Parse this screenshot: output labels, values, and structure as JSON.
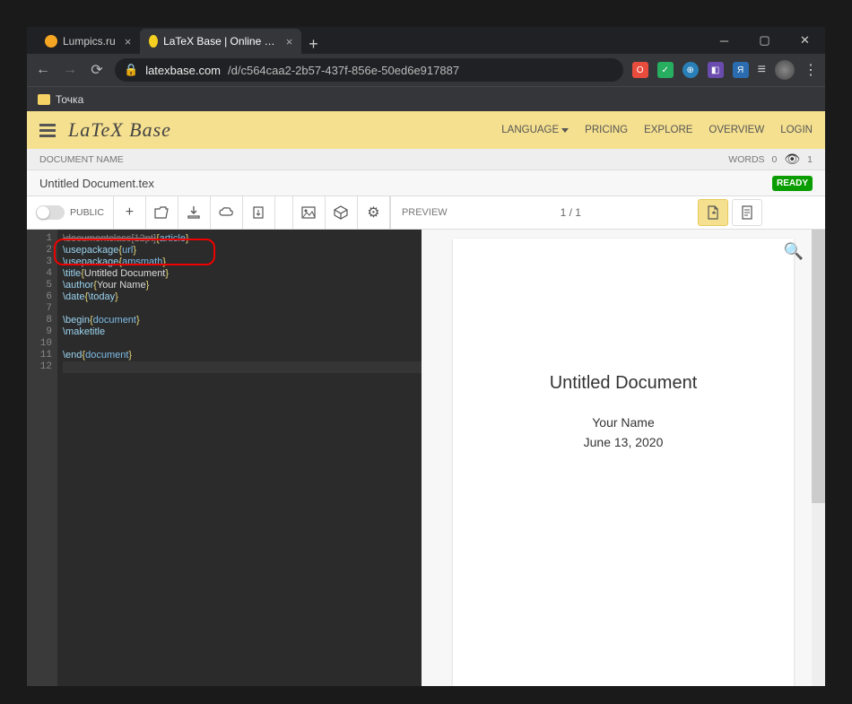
{
  "browser": {
    "tabs": [
      {
        "title": "Lumpics.ru",
        "favicon": "#f5a623",
        "active": false
      },
      {
        "title": "LaTeX Base | Online LaTeX Editor",
        "favicon": "#f5d020",
        "active": true
      }
    ],
    "url_domain": "latexbase.com",
    "url_path": "/d/c564caa2-2b57-437f-856e-50ed6e917887",
    "bookmark": "Точка"
  },
  "app": {
    "brand": "LaTeX Base",
    "nav": {
      "language": "LANGUAGE",
      "pricing": "PRICING",
      "explore": "EXPLORE",
      "overview": "OVERVIEW",
      "login": "LOGIN"
    },
    "docname_label": "DOCUMENT NAME",
    "words_label": "WORDS",
    "words_count": "0",
    "views_count": "1",
    "filename": "Untitled Document.tex",
    "ready": "READY",
    "public_label": "PUBLIC",
    "preview_label": "PREVIEW",
    "page_indicator": "1 / 1"
  },
  "code": {
    "lines": [
      {
        "n": "1",
        "parts": [
          {
            "t": "\\documentclass",
            "c": "tok-comment"
          },
          {
            "t": "[12pt]",
            "c": "tok-comment"
          },
          {
            "t": "{",
            "c": "tok-brace"
          },
          {
            "t": "article",
            "c": "tok-arg"
          },
          {
            "t": "}",
            "c": "tok-brace"
          }
        ]
      },
      {
        "n": "2",
        "parts": [
          {
            "t": "\\usepackage",
            "c": "tok-cmd"
          },
          {
            "t": "{",
            "c": "tok-brace"
          },
          {
            "t": "url",
            "c": "tok-arg"
          },
          {
            "t": "}",
            "c": "tok-brace"
          }
        ]
      },
      {
        "n": "3",
        "parts": [
          {
            "t": "\\usepackage",
            "c": "tok-cmd"
          },
          {
            "t": "{",
            "c": "tok-brace"
          },
          {
            "t": "amsmath",
            "c": "tok-arg"
          },
          {
            "t": "}",
            "c": "tok-brace"
          }
        ]
      },
      {
        "n": "4",
        "parts": [
          {
            "t": "\\title",
            "c": "tok-cmd"
          },
          {
            "t": "{",
            "c": "tok-brace"
          },
          {
            "t": "Untitled Document",
            "c": ""
          },
          {
            "t": "}",
            "c": "tok-brace"
          }
        ]
      },
      {
        "n": "5",
        "parts": [
          {
            "t": "\\author",
            "c": "tok-cmd"
          },
          {
            "t": "{",
            "c": "tok-brace"
          },
          {
            "t": "Your Name",
            "c": ""
          },
          {
            "t": "}",
            "c": "tok-brace"
          }
        ]
      },
      {
        "n": "6",
        "parts": [
          {
            "t": "\\date",
            "c": "tok-cmd"
          },
          {
            "t": "{",
            "c": "tok-brace"
          },
          {
            "t": "\\today",
            "c": "tok-cmd"
          },
          {
            "t": "}",
            "c": "tok-brace"
          }
        ]
      },
      {
        "n": "7",
        "parts": []
      },
      {
        "n": "8",
        "parts": [
          {
            "t": "\\begin",
            "c": "tok-cmd"
          },
          {
            "t": "{",
            "c": "tok-brace"
          },
          {
            "t": "document",
            "c": "tok-arg"
          },
          {
            "t": "}",
            "c": "tok-brace"
          }
        ]
      },
      {
        "n": "9",
        "parts": [
          {
            "t": "\\maketitle",
            "c": "tok-cmd"
          }
        ]
      },
      {
        "n": "10",
        "parts": []
      },
      {
        "n": "11",
        "parts": [
          {
            "t": "\\end",
            "c": "tok-cmd"
          },
          {
            "t": "{",
            "c": "tok-brace"
          },
          {
            "t": "document",
            "c": "tok-arg"
          },
          {
            "t": "}",
            "c": "tok-brace"
          }
        ]
      },
      {
        "n": "12",
        "parts": []
      }
    ]
  },
  "preview": {
    "title": "Untitled Document",
    "author": "Your Name",
    "date": "June 13, 2020"
  }
}
